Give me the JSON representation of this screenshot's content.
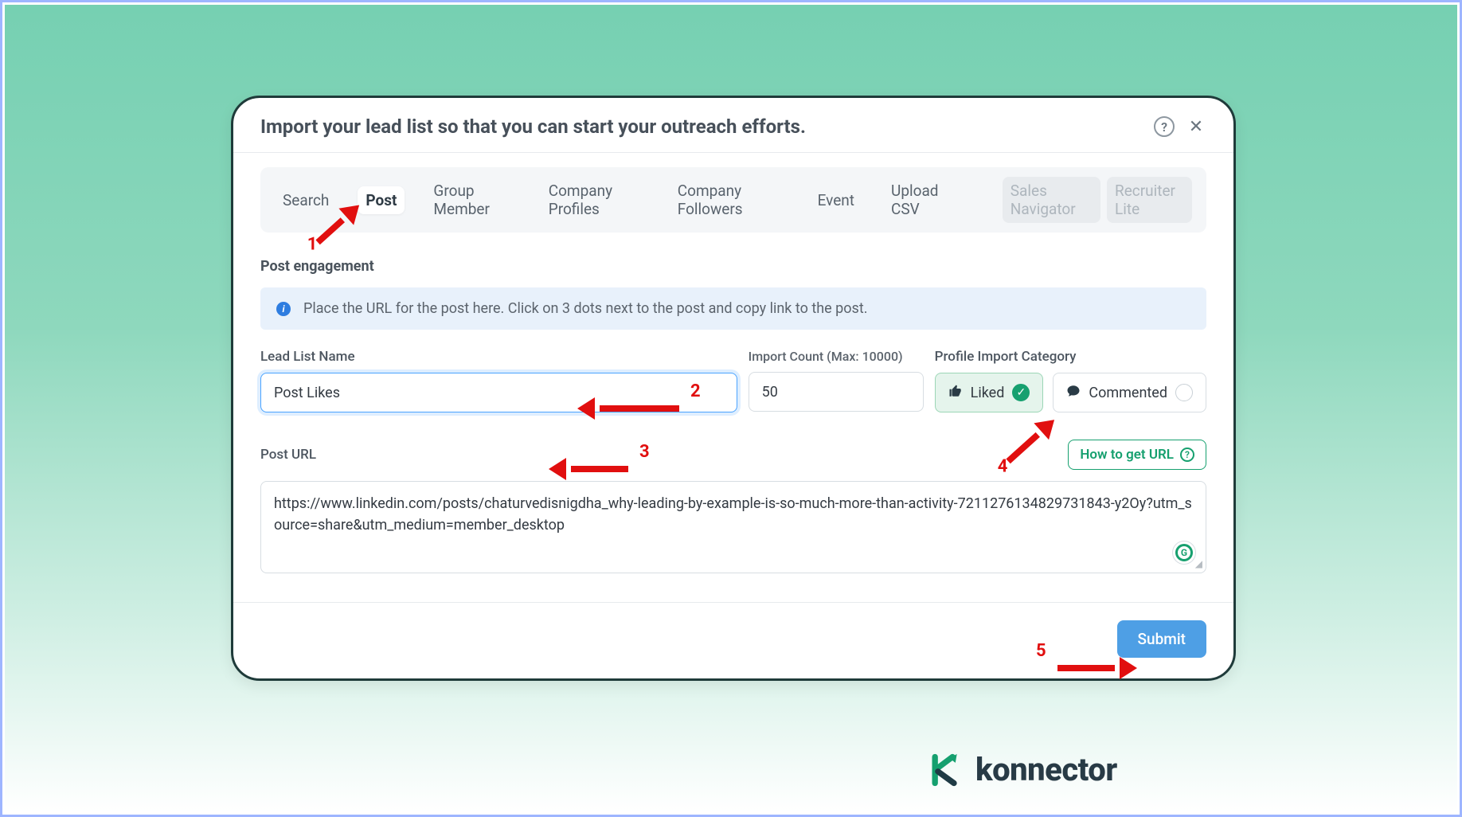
{
  "modal": {
    "title": "Import your lead list so that you can start your outreach efforts."
  },
  "tabs": [
    "Search",
    "Post",
    "Group Member",
    "Company Profiles",
    "Company Followers",
    "Event",
    "Upload CSV",
    "Sales Navigator",
    "Recruiter Lite"
  ],
  "activeTab": "Post",
  "disabledTabs": [
    "Sales Navigator",
    "Recruiter Lite"
  ],
  "section": {
    "title": "Post engagement"
  },
  "info": {
    "text": "Place the URL for the post here. Click on 3 dots next to the post and copy link to the post."
  },
  "fields": {
    "leadList": {
      "label": "Lead List Name",
      "value": "Post Likes"
    },
    "importCount": {
      "label": "Import Count (Max: 10000)",
      "value": "50"
    },
    "category": {
      "label": "Profile Import Category",
      "options": [
        {
          "key": "liked",
          "label": "Liked",
          "selected": true
        },
        {
          "key": "commented",
          "label": "Commented",
          "selected": false
        }
      ]
    },
    "postUrl": {
      "label": "Post URL",
      "howto": "How to get URL",
      "value": "https://www.linkedin.com/posts/chaturvedisnigdha_why-leading-by-example-is-so-much-more-than-activity-7211276134829731843-y2Oy?utm_source=share&utm_medium=member_desktop"
    }
  },
  "submit": {
    "label": "Submit"
  },
  "annotations": [
    "1",
    "2",
    "3",
    "4",
    "5"
  ],
  "brand": {
    "name": "konnector"
  }
}
